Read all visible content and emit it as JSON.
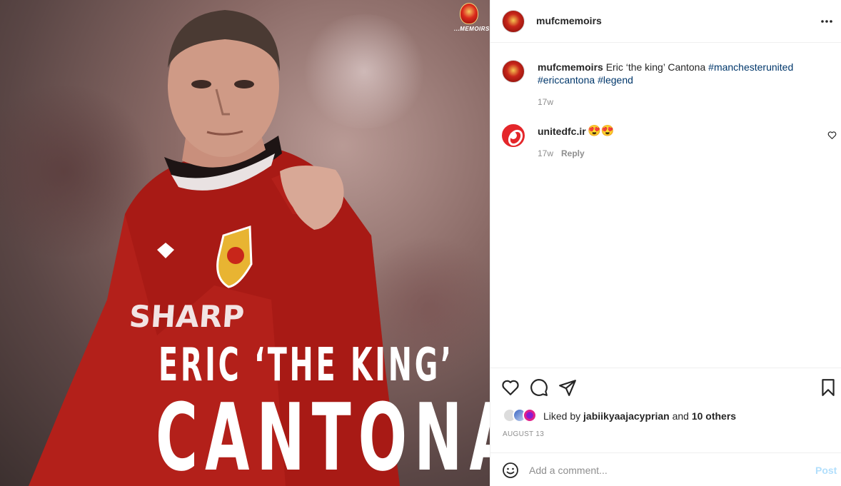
{
  "post": {
    "username": "mufcmemoirs",
    "logo_tag": "...MEMOIRS",
    "image_text_line1": "ERIC ‘THE KING’",
    "image_text_line2": "CANTONA",
    "shirt_sponsor": "SHARP"
  },
  "caption": {
    "username": "mufcmemoirs",
    "text": "Eric ‘the king’ Cantona",
    "hashtags": [
      "#manchesterunited",
      "#ericcantona",
      "#legend"
    ],
    "time": "17w"
  },
  "comments": [
    {
      "username": "unitedfc.ir",
      "text": "😍😍",
      "time": "17w",
      "reply_label": "Reply"
    }
  ],
  "actions": {
    "icons": [
      "heart-icon",
      "comment-icon",
      "share-icon",
      "bookmark-icon"
    ]
  },
  "likes": {
    "prefix": "Liked by",
    "first_user": "jabiikyaajacyprian",
    "conjunction": "and",
    "others": "10 others"
  },
  "date": "AUGUST 13",
  "comment_box": {
    "placeholder": "Add a comment...",
    "post_label": "Post"
  },
  "colors": {
    "hashtag": "#00376b",
    "muted": "#8e8e8e",
    "post_disabled": "#b2dffc",
    "jersey_red": "#c8261a"
  }
}
